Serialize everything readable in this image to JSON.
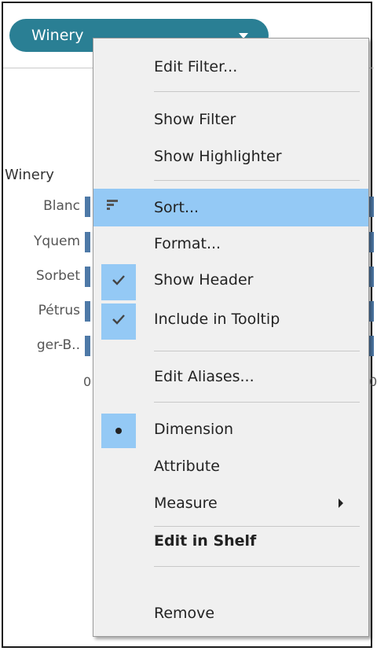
{
  "filter_pill": {
    "label": "Winery"
  },
  "row_shelf": {
    "header": "Winery",
    "rows": [
      "Blanc",
      "Yquem",
      "Sorbet",
      "Pétrus",
      "ger-B.."
    ],
    "axis_tick_left": "0",
    "axis_tick_right": "0"
  },
  "context_menu": {
    "edit_filter": "Edit Filter...",
    "show_filter": "Show Filter",
    "show_highlighter": "Show Highlighter",
    "sort": "Sort...",
    "format": "Format...",
    "show_header": "Show Header",
    "include_in_tooltip": "Include in Tooltip",
    "edit_aliases": "Edit Aliases...",
    "dimension": "Dimension",
    "attribute": "Attribute",
    "measure": "Measure",
    "edit_in_shelf": "Edit in Shelf",
    "remove": "Remove"
  },
  "colors": {
    "pill": "#2a7f94",
    "highlight": "#94c9f5",
    "bar": "#4e79a7"
  }
}
